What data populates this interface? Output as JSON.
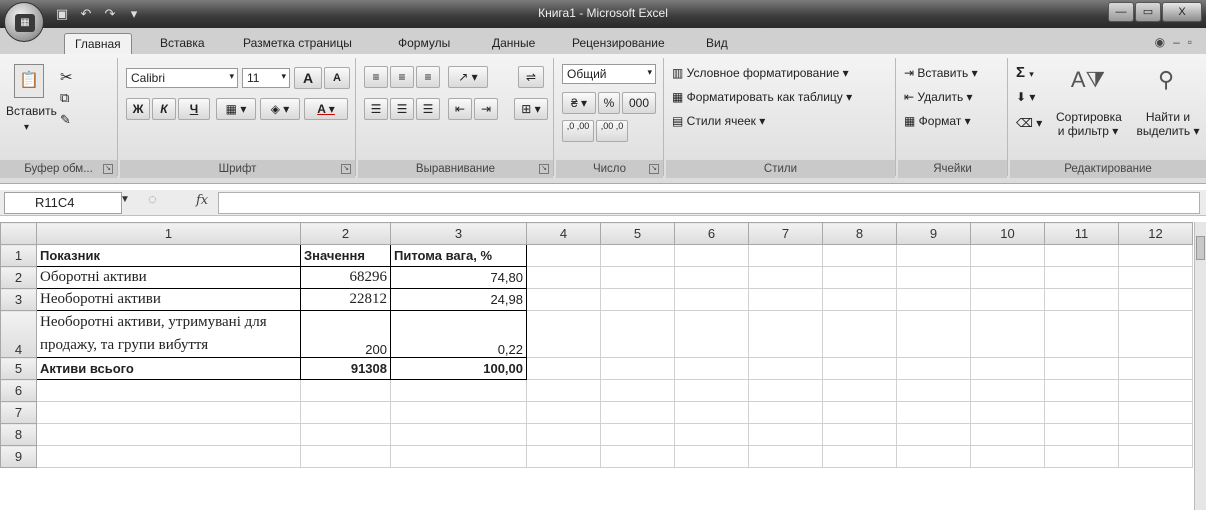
{
  "window": {
    "title": "Книга1 - Microsoft Excel",
    "minimize": "—",
    "maximize": "▭",
    "close": "X"
  },
  "tabs": [
    "Главная",
    "Вставка",
    "Разметка страницы",
    "Формулы",
    "Данные",
    "Рецензирование",
    "Вид"
  ],
  "ribbon": {
    "clipboard": {
      "paste": "Вставить",
      "label": "Буфер обм..."
    },
    "font": {
      "name": "Calibri",
      "size": "11",
      "bold": "Ж",
      "italic": "К",
      "underline": "Ч",
      "grow": "A",
      "shrink": "A",
      "font_color": "A",
      "label": "Шрифт"
    },
    "alignment": {
      "label": "Выравнивание"
    },
    "number": {
      "format": "Общий",
      "percent": "%",
      "thousands": "000",
      "inc_dec": ",0 ,00",
      "dec_dec": ",00 ,0",
      "label": "Число"
    },
    "styles": {
      "conditional": "Условное форматирование",
      "format_table": "Форматировать как таблицу",
      "cell_styles": "Стили ячеек",
      "label": "Стили"
    },
    "cells": {
      "insert": "Вставить",
      "delete": "Удалить",
      "format": "Формат",
      "label": "Ячейки"
    },
    "editing": {
      "sum": "Σ",
      "sort_line1": "Сортировка",
      "sort_line2": "и фильтр",
      "find_line1": "Найти и",
      "find_line2": "выделить",
      "label": "Редактирование"
    }
  },
  "formula_bar": {
    "name_box": "R11C4",
    "fx": "fx",
    "value": ""
  },
  "grid": {
    "columns": [
      "1",
      "2",
      "3",
      "4",
      "5",
      "6",
      "7",
      "8",
      "9",
      "10",
      "11",
      "12"
    ],
    "rows": [
      {
        "n": "1",
        "a": "Показник",
        "b": "Значення",
        "c": "Питома вага, %"
      },
      {
        "n": "2",
        "a": "Оборотні активи",
        "b": "68296",
        "c": "74,80"
      },
      {
        "n": "3",
        "a": "Необоротні активи",
        "b": "22812",
        "c": "24,98"
      },
      {
        "n": "4",
        "a": "Необоротні активи, утримувані для продажу, та групи вибуття",
        "b": "200",
        "c": "0,22"
      },
      {
        "n": "5",
        "a": "Активи всього",
        "b": "91308",
        "c": "100,00"
      },
      {
        "n": "6"
      },
      {
        "n": "7"
      },
      {
        "n": "8"
      },
      {
        "n": "9"
      }
    ]
  }
}
